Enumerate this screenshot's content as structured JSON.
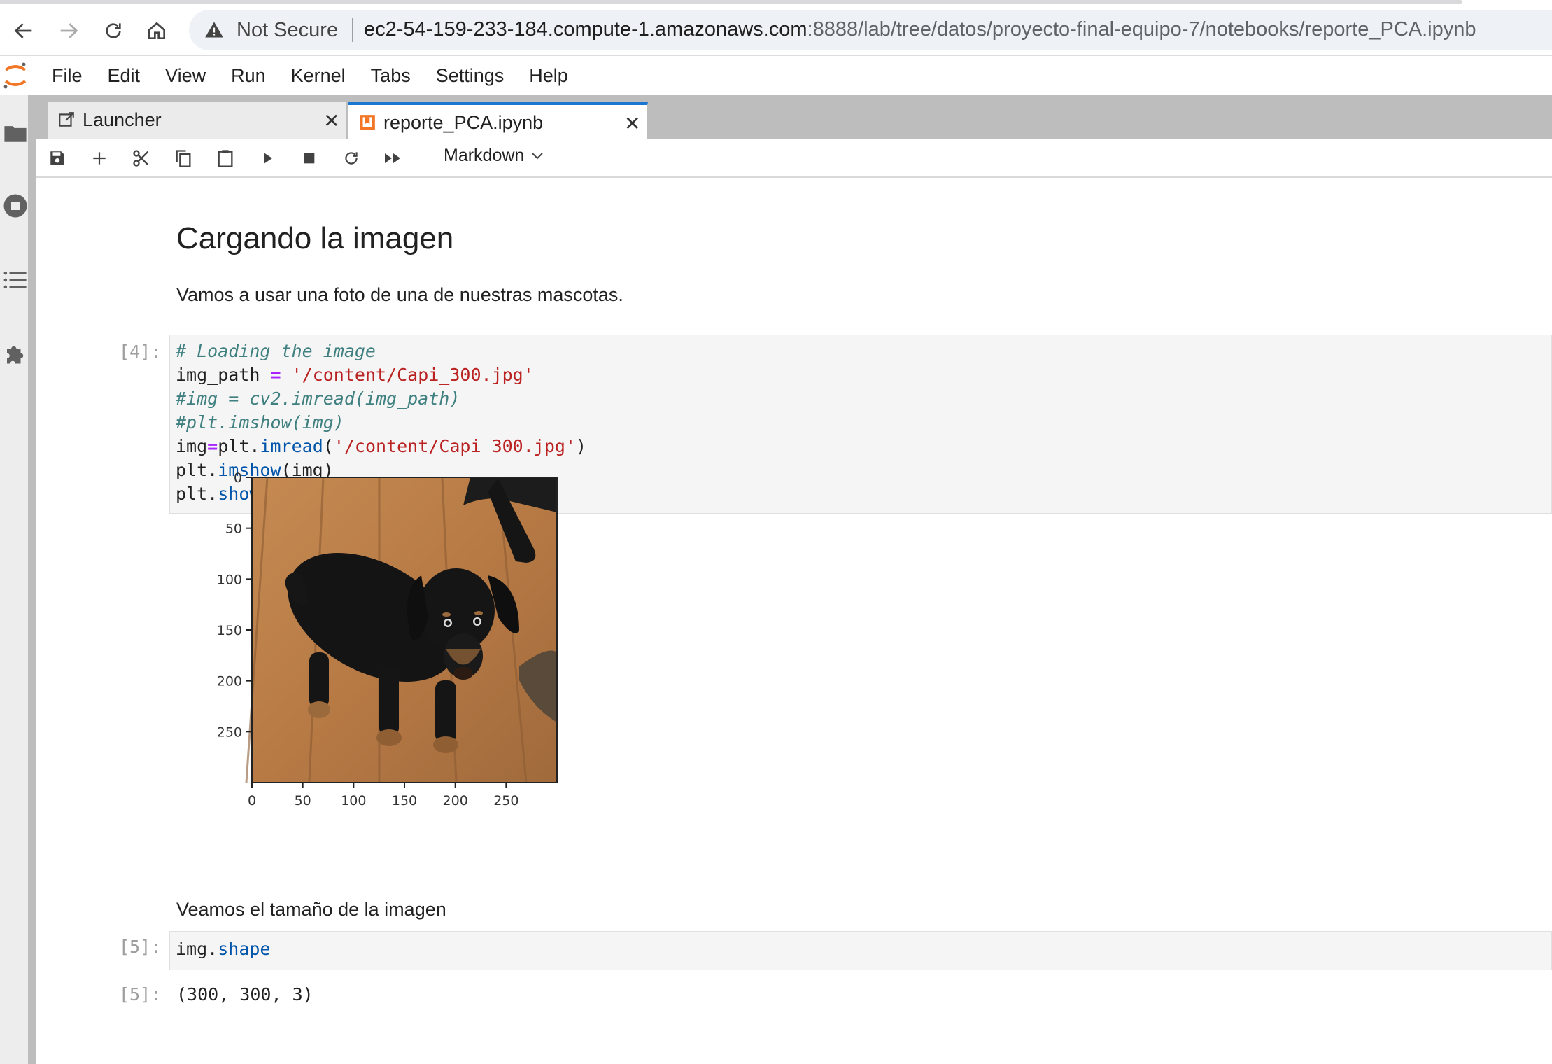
{
  "browser": {
    "security_label": "Not Secure",
    "url_host": "ec2-54-159-233-184.compute-1.amazonaws.com",
    "url_path": ":8888/lab/tree/datos/proyecto-final-equipo-7/notebooks/reporte_PCA.ipynb"
  },
  "menu": [
    "File",
    "Edit",
    "View",
    "Run",
    "Kernel",
    "Tabs",
    "Settings",
    "Help"
  ],
  "tabs": [
    {
      "label": "Launcher",
      "icon": "launcher-icon"
    },
    {
      "label": "reporte_PCA.ipynb",
      "icon": "notebook-icon"
    }
  ],
  "toolbar": {
    "cell_type": "Markdown"
  },
  "notebook": {
    "heading": "Cargando la imagen",
    "intro": "Vamos a usar una foto de una de nuestras mascotas.",
    "cell4": {
      "prompt": "[4]:",
      "lines": [
        "# Loading the image",
        "img_path = '/content/Capi_300.jpg'",
        "#img = cv2.imread(img_path)",
        "#plt.imshow(img)",
        "img=plt.imread('/content/Capi_300.jpg')",
        "plt.imshow(img)",
        "plt.show()"
      ]
    },
    "size_text": "Veamos el tamaño de la imagen",
    "cell5": {
      "prompt": "[5]:",
      "code": "img.shape",
      "out_prompt": "[5]:",
      "output": "(300, 300, 3)"
    }
  },
  "chart_data": {
    "type": "image",
    "xlim": [
      0,
      300
    ],
    "ylim": [
      0,
      300
    ],
    "x_ticks": [
      0,
      50,
      100,
      150,
      200,
      250
    ],
    "y_ticks": [
      0,
      50,
      100,
      150,
      200,
      250
    ],
    "content": "photo of a black and tan dachshund on a wooden floor"
  },
  "colors": {
    "accent": "#1976d2",
    "jupyter_orange": "#f37626"
  }
}
